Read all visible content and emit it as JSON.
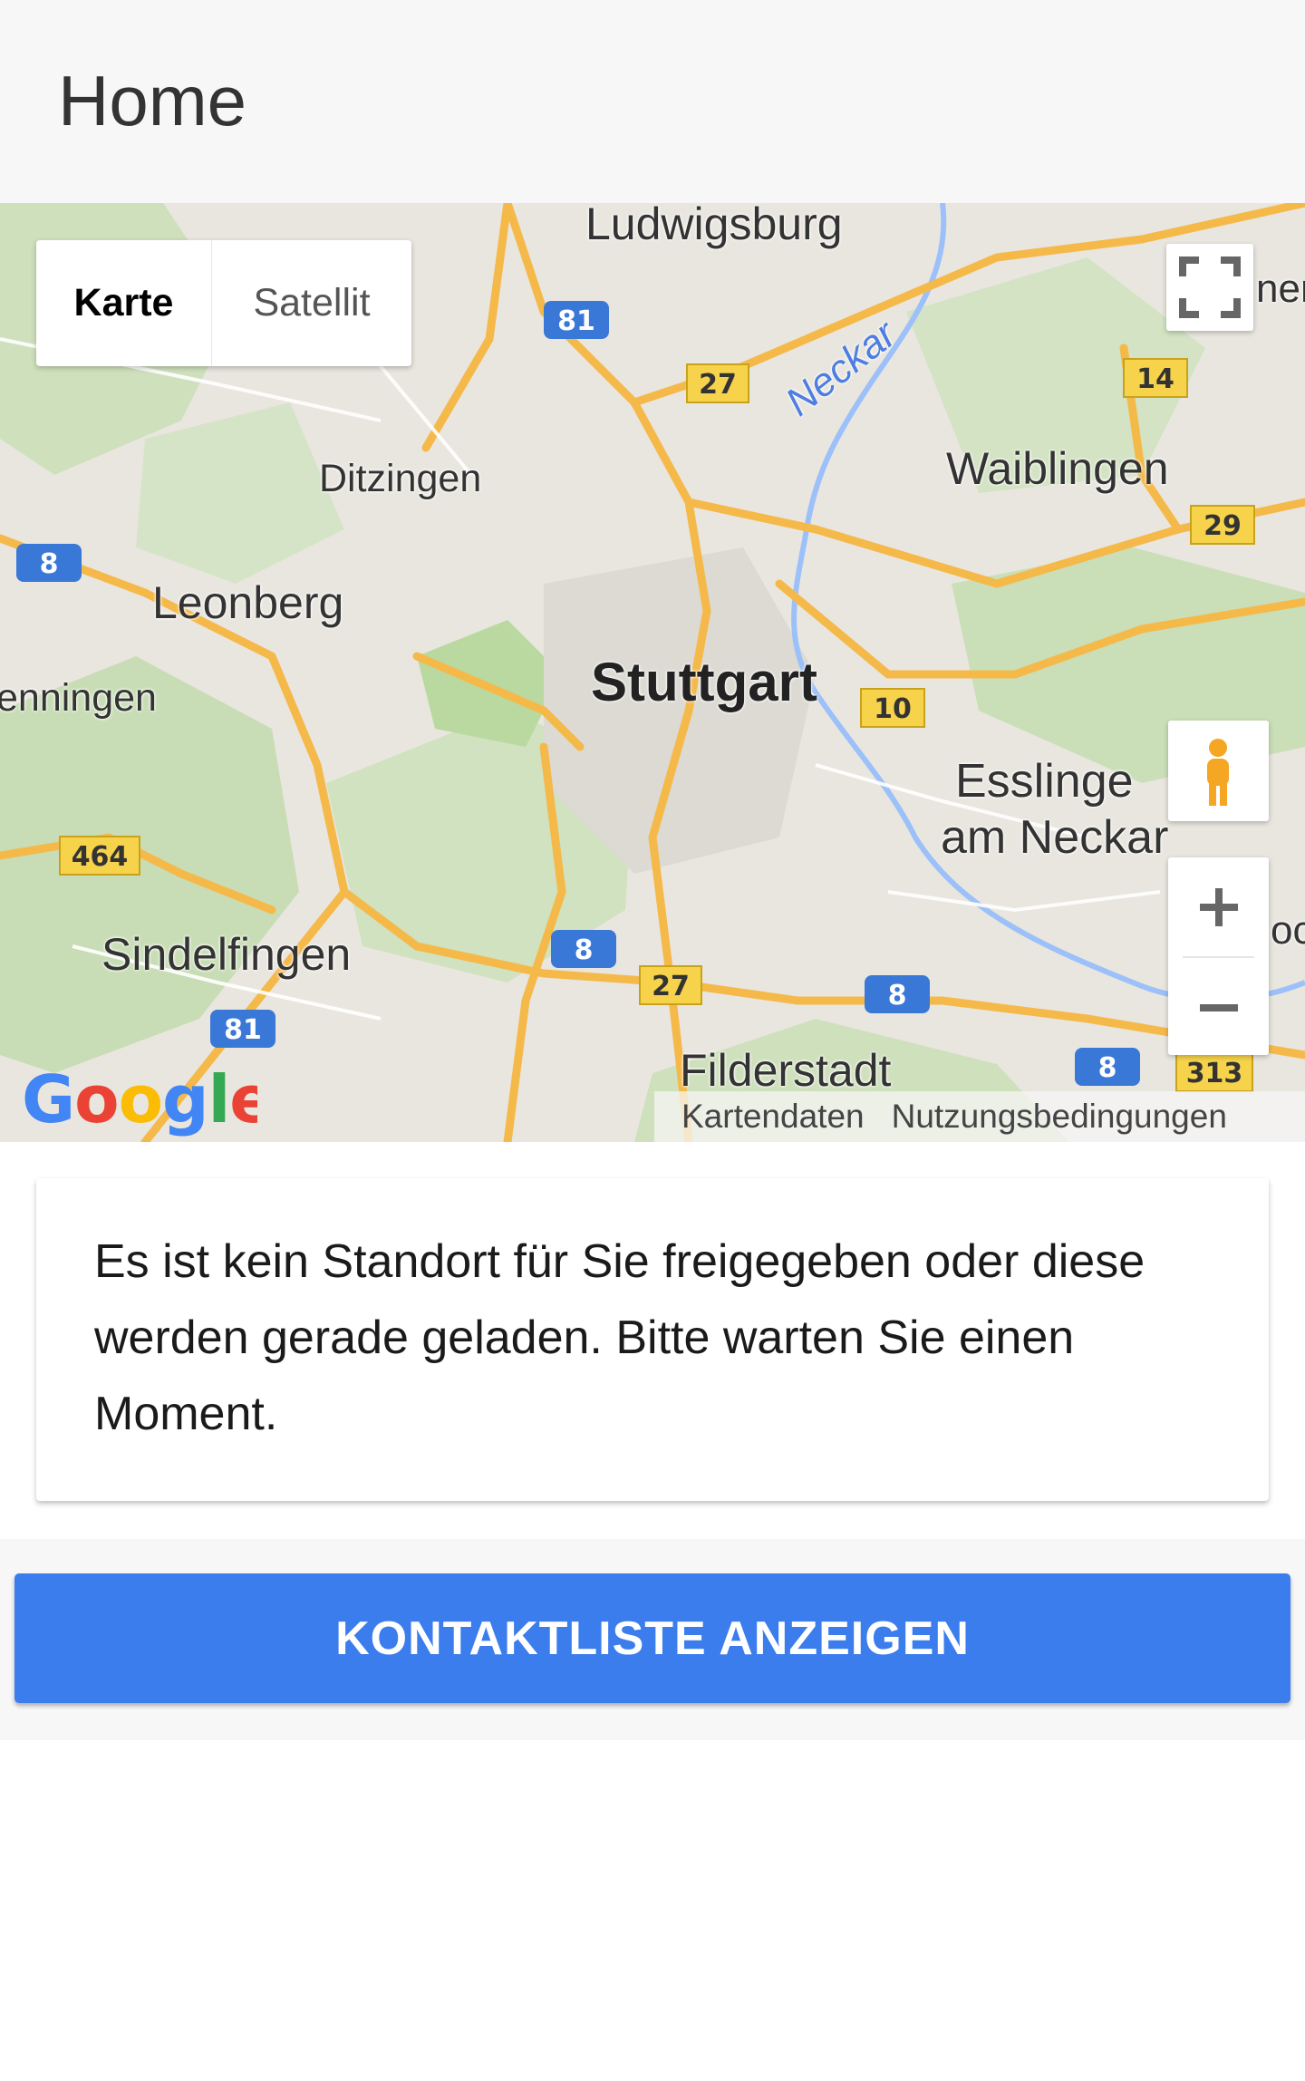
{
  "header": {
    "title": "Home"
  },
  "map": {
    "type_buttons": {
      "map": "Karte",
      "satellite": "Satellit"
    },
    "labels": {
      "ludwigsburg": "Ludwigsburg",
      "ditzingen": "Ditzingen",
      "leonberg": "Leonberg",
      "renningen": "enningen",
      "stuttgart": "Stuttgart",
      "waiblingen": "Waiblingen",
      "esslingen": "Esslinge",
      "esslingen2": "am Neckar",
      "sindelfingen": "Sindelfingen",
      "filderstadt": "Filderstadt",
      "neckar": "Neckar",
      "ner": "ner",
      "oc": "oc"
    },
    "road_shields": {
      "a81_top": "81",
      "a8_left": "8",
      "b27_top": "27",
      "b14": "14",
      "b29": "29",
      "b10": "10",
      "b464": "464",
      "a8_mid": "8",
      "b27_bottom": "27",
      "a8_right": "8",
      "a81_bottom": "81",
      "a8_far": "8",
      "b313": "313"
    },
    "google_logo": "Google",
    "attribution": {
      "data": "Kartendaten",
      "terms": "Nutzungsbedingungen"
    },
    "icons": {
      "fullscreen": "fullscreen-icon",
      "pegman": "pegman-icon",
      "zoom_in": "plus-icon",
      "zoom_out": "minus-icon"
    }
  },
  "info_card": {
    "text": "Es ist kein Standort für Sie freigegeben oder diese werden gerade geladen. Bitte warten Sie einen Moment."
  },
  "actions": {
    "contact_list_button": "KONTAKTLISTE ANZEIGEN"
  },
  "colors": {
    "accent": "#3b7ded",
    "header_bg": "#f7f7f7",
    "motorway": "#3a78d8",
    "federal_road": "#f6d34b",
    "road": "#f5b94a"
  }
}
